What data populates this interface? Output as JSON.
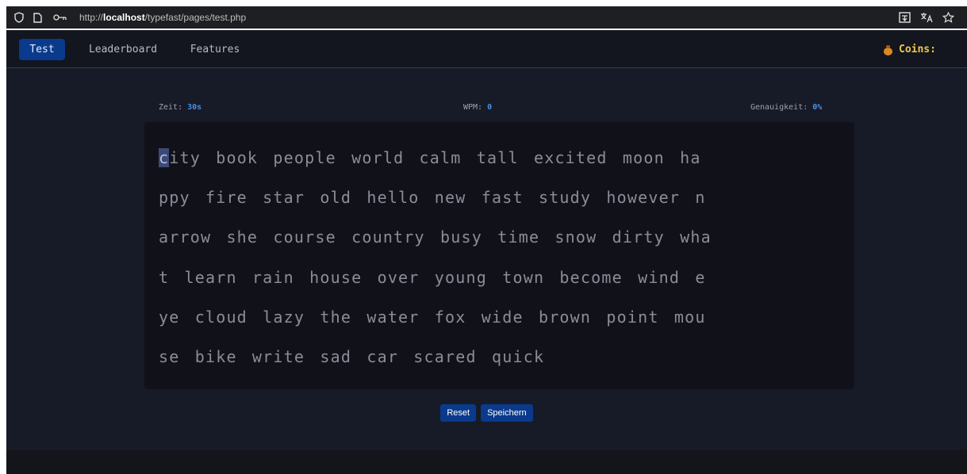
{
  "browser": {
    "url_scheme": "http://",
    "url_host": "localhost",
    "url_path": "/typefast/pages/test.php"
  },
  "nav": {
    "items": [
      {
        "label": "Test",
        "active": true
      },
      {
        "label": "Leaderboard",
        "active": false
      },
      {
        "label": "Features",
        "active": false
      }
    ],
    "coins_label": "Coins:"
  },
  "stats": {
    "time_label": "Zeit:",
    "time_value": "30s",
    "wpm_label": "WPM:",
    "wpm_value": "0",
    "accuracy_label": "Genauigkeit:",
    "accuracy_value": "0%"
  },
  "typing": {
    "first_char": "c",
    "lines": [
      "ity book people world calm tall excited moon ha",
      "ppy fire star old hello new fast study however n",
      "arrow she course country busy time snow dirty wha",
      "t learn rain house over young town become wind e",
      "ye cloud lazy the water fox wide brown point mou",
      "se bike write sad car scared quick"
    ]
  },
  "actions": {
    "reset_label": "Reset",
    "save_label": "Speichern"
  },
  "colors": {
    "accent": "#0a3a8c",
    "background": "#171a27",
    "stat_value": "#4a90e2",
    "coins": "#f0c94a"
  }
}
